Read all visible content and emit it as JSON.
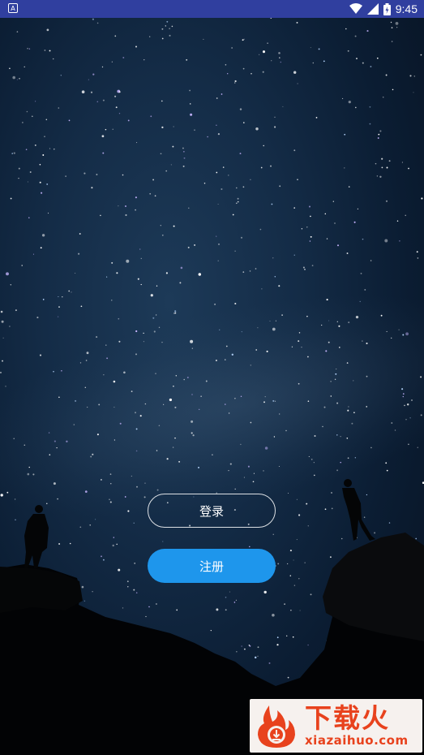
{
  "status_bar": {
    "notification_icon": "A",
    "time": "9:45",
    "icons": [
      "wifi-icon",
      "signal-icon",
      "battery-icon"
    ]
  },
  "buttons": {
    "login_label": "登录",
    "register_label": "注册"
  },
  "watermark": {
    "title": "下载火",
    "subtitle": "xiazaihuo.com"
  },
  "colors": {
    "status_bar": "#303f9f",
    "register_button": "#1e96ec",
    "watermark_accent": "#e8421d"
  }
}
